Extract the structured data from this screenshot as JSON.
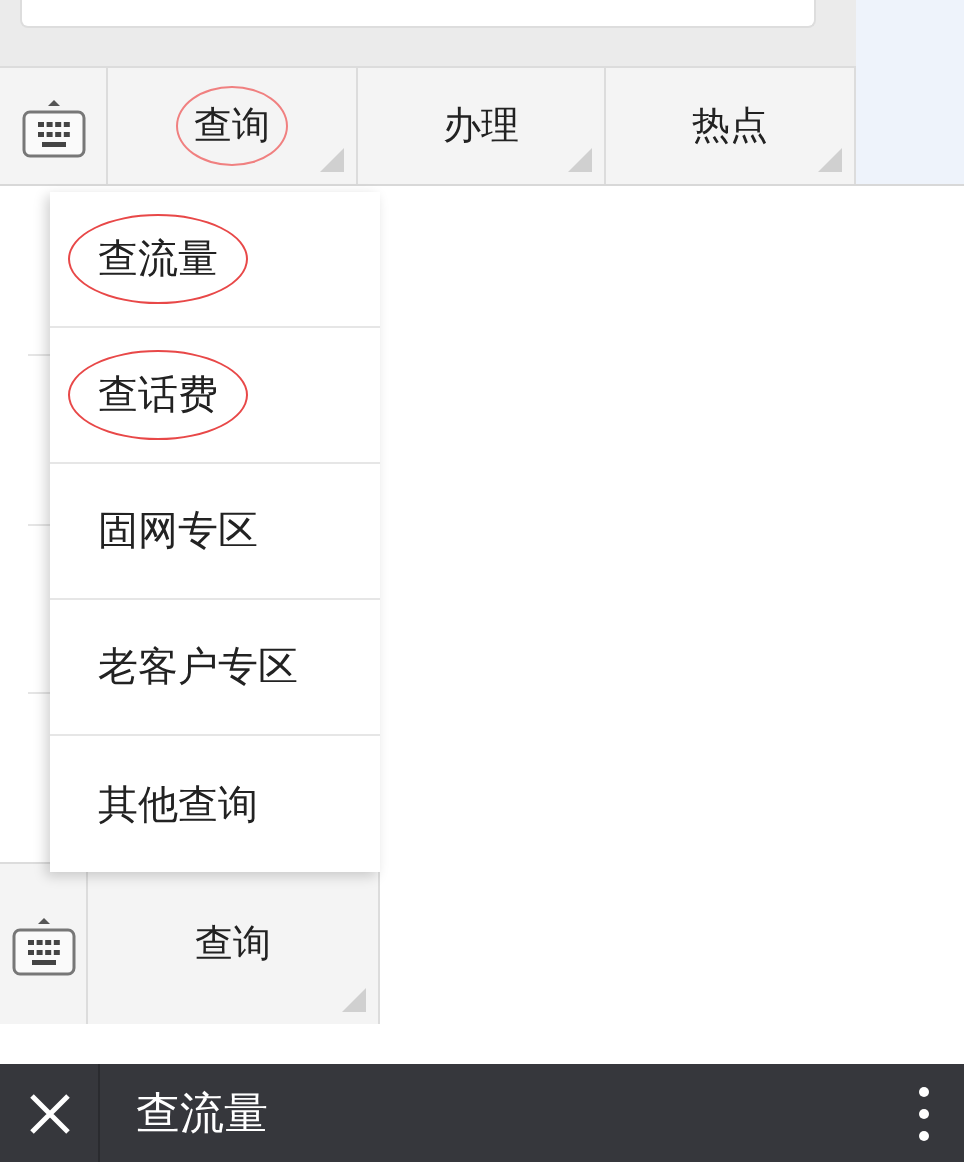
{
  "top_menu": {
    "tabs": [
      {
        "label": "查询",
        "circled": true
      },
      {
        "label": "办理",
        "circled": false
      },
      {
        "label": "热点",
        "circled": false
      }
    ]
  },
  "dropdown": {
    "items": [
      {
        "label": "查流量",
        "circled": true
      },
      {
        "label": "查话费",
        "circled": true
      },
      {
        "label": "固网专区",
        "circled": false
      },
      {
        "label": "老客户专区",
        "circled": false
      },
      {
        "label": "其他查询",
        "circled": false
      }
    ]
  },
  "bottom_menu": {
    "tabs": [
      {
        "label": "查询"
      }
    ]
  },
  "title_bar": {
    "title": "查流量"
  }
}
